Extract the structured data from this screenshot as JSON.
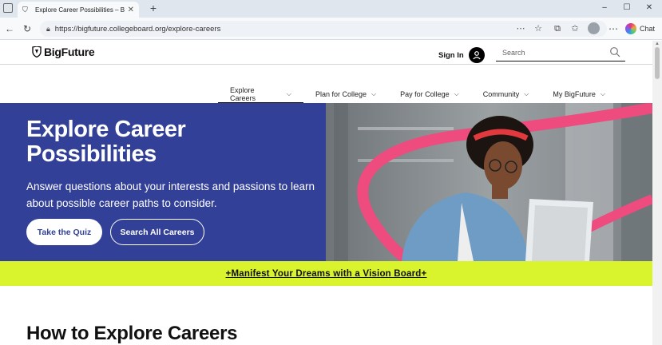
{
  "browser": {
    "tab_title": "Explore Career Possibilities – BigFu",
    "url": "https://bigfuture.collegeboard.org/explore-careers",
    "copilot_label": "Chat"
  },
  "site": {
    "logo_text": "BigFuture",
    "signin_label": "Sign In",
    "search_placeholder": "Search"
  },
  "nav": {
    "items": [
      {
        "label": "Explore Careers"
      },
      {
        "label": "Plan for College"
      },
      {
        "label": "Pay for College"
      },
      {
        "label": "Community"
      },
      {
        "label": "My BigFuture"
      }
    ]
  },
  "hero": {
    "title_line1": "Explore Career",
    "title_line2": "Possibilities",
    "subtitle": "Answer questions about your interests and passions to learn about possible career paths to consider.",
    "primary_button": "Take the Quiz",
    "secondary_button": "Search All Careers",
    "bg_color": "#324097"
  },
  "banner": {
    "text": "+Manifest Your Dreams with a Vision Board+",
    "bg_color": "#d9f32c"
  },
  "section": {
    "title": "How to Explore Careers"
  }
}
